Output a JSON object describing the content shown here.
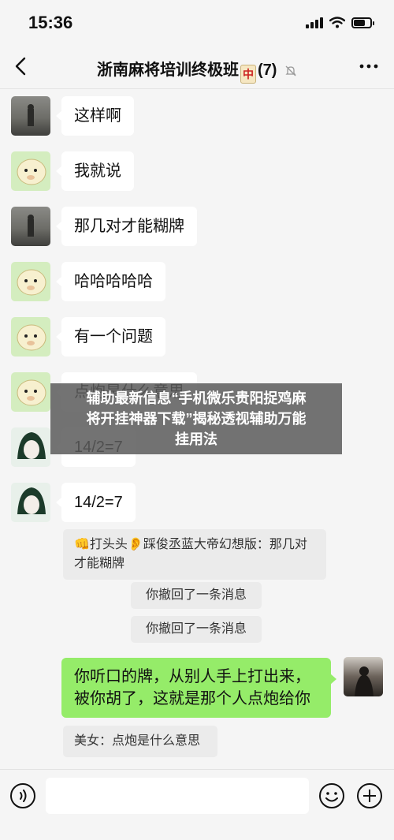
{
  "status_bar": {
    "time": "15:36"
  },
  "header": {
    "title": "浙南麻将培训终极班",
    "tile": "中",
    "count": "(7)"
  },
  "messages": [
    {
      "text": "这样啊"
    },
    {
      "text": "我就说"
    },
    {
      "text": "那几对才能糊牌"
    },
    {
      "text": "哈哈哈哈哈"
    },
    {
      "text": "有一个问题"
    },
    {
      "text": "点炮是什么意思"
    },
    {
      "text": "14/2=7"
    },
    {
      "text": "14/2=7"
    }
  ],
  "quote": {
    "emoji1": "👊",
    "emoji2": "👂",
    "text": "打头头",
    "text2": "踩俊丞蓝大帝幻想版：那几对才能糊牌"
  },
  "system_messages": [
    "你撤回了一条消息",
    "你撤回了一条消息"
  ],
  "my_message": {
    "line1": "你听口的牌，从别人手上打出来，",
    "line2": "被你胡了，这就是那个人点炮给你"
  },
  "my_quote": {
    "text": "美女：点炮是什么意思"
  },
  "overlay": {
    "line1": "辅助最新信息“手机微乐贵阳捉鸡麻",
    "line2": "将开挂神器下载”揭秘透视辅助万能",
    "line3": "挂用法"
  },
  "input_bar": {
    "placeholder": ""
  }
}
